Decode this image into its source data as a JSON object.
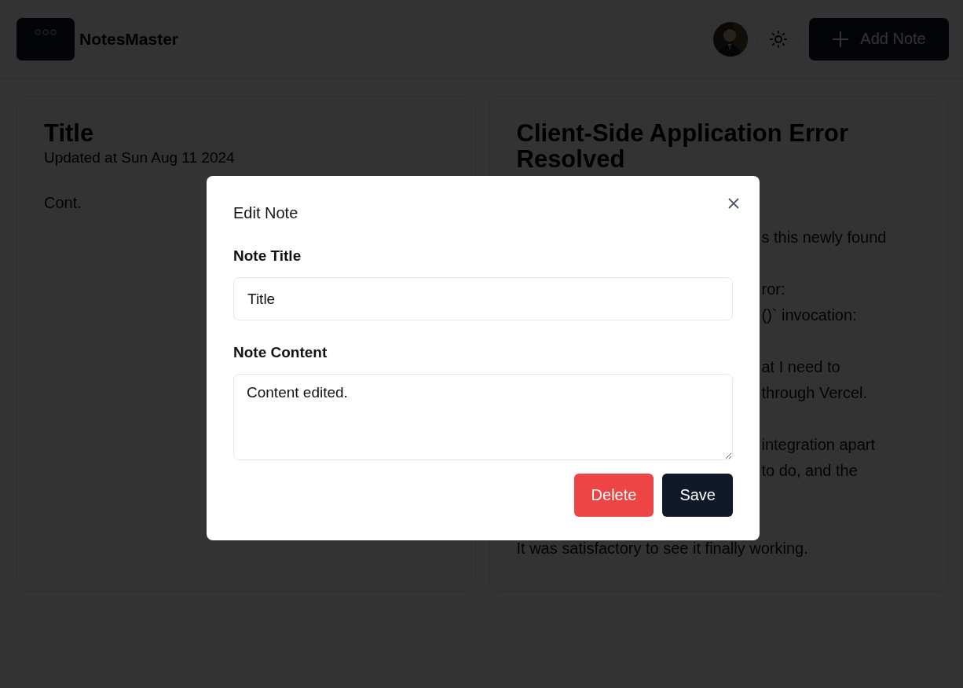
{
  "header": {
    "logo_name": "NotesMaster",
    "add_button": "Add Note"
  },
  "notes": [
    {
      "title": "Title",
      "updated": "Updated at Sun Aug 11 2024",
      "paragraphs": [
        {
          "kind": "full",
          "lines": [
            "Cont."
          ]
        }
      ]
    },
    {
      "title": "Client-Side Application Error Resolved",
      "paragraphs": [
        {
          "kind": "partial",
          "lines": [
            "s this newly found"
          ]
        },
        {
          "kind": "partial",
          "lines": [
            "ror:",
            "()` invocation:"
          ]
        },
        {
          "kind": "partial",
          "lines": [
            "at I need to",
            "through Vercel."
          ]
        },
        {
          "kind": "partial",
          "lines": [
            "integration apart",
            "to do, and the"
          ]
        },
        {
          "kind": "full",
          "lines": [
            "It was satisfactory to see it finally working."
          ]
        }
      ]
    }
  ],
  "dialog": {
    "title": "Edit Note",
    "fields": [
      {
        "kind": "input",
        "label": "Note Title",
        "value": "Title"
      },
      {
        "kind": "textarea",
        "label": "Note Content",
        "value": "Content edited."
      }
    ],
    "buttons": [
      {
        "kind": "danger",
        "label": "Delete"
      },
      {
        "kind": "primary",
        "label": "Save"
      }
    ]
  }
}
